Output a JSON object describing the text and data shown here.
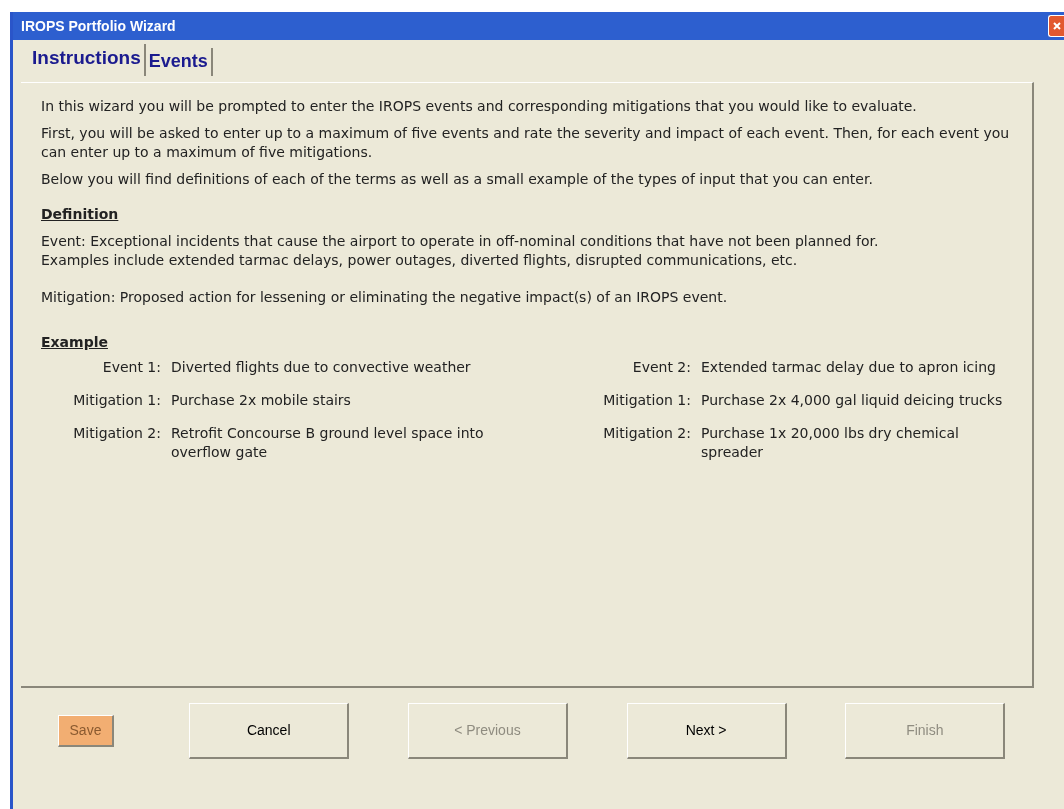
{
  "window": {
    "title": "IROPS Portfolio Wizard"
  },
  "tabs": [
    {
      "label": "Instructions",
      "selected": true
    },
    {
      "label": "Events",
      "selected": false
    }
  ],
  "intro": [
    "In this wizard you will be prompted to enter the IROPS events and corresponding mitigations that you would like to evaluate.",
    "First, you will be asked to enter up to a maximum of five events and rate the severity and impact of each event.  Then, for each event you can enter up to a maximum of five mitigations.",
    "Below you will find definitions of each of the terms as well as a small example of the types of input that you can enter."
  ],
  "definition": {
    "heading": "Definition",
    "paragraphs": [
      "Event: Exceptional incidents that cause the airport to operate in off-nominal conditions that have not been planned for. Examples include extended tarmac delays, power outages, diverted flights, disrupted communications, etc.",
      "Mitigation: Proposed action for lessening or eliminating the negative impact(s) of an IROPS event."
    ]
  },
  "example": {
    "heading": "Example",
    "rows": [
      {
        "left": {
          "label": "Event 1:",
          "text": "Diverted flights due to convective weather"
        },
        "right": {
          "label": "Event 2:",
          "text": "Extended tarmac delay due to apron icing"
        }
      },
      {
        "left": {
          "label": "Mitigation 1:",
          "text": "Purchase 2x mobile stairs"
        },
        "right": {
          "label": "Mitigation 1:",
          "text": "Purchase 2x 4,000 gal liquid deicing trucks"
        }
      },
      {
        "left": {
          "label": "Mitigation 2:",
          "text": "Retrofit Concourse B ground level space into overflow gate"
        },
        "right": {
          "label": "Mitigation 2:",
          "text": "Purchase 1x 20,000 lbs dry chemical spreader"
        }
      }
    ]
  },
  "buttons": [
    {
      "label": "Save",
      "kind": "small",
      "disabled": true
    },
    {
      "label": "Cancel",
      "kind": "large",
      "disabled": false
    },
    {
      "label": "< Previous",
      "kind": "large",
      "disabled": true
    },
    {
      "label": "Next >",
      "kind": "large",
      "disabled": false
    },
    {
      "label": "Finish",
      "kind": "large",
      "disabled": true
    }
  ]
}
